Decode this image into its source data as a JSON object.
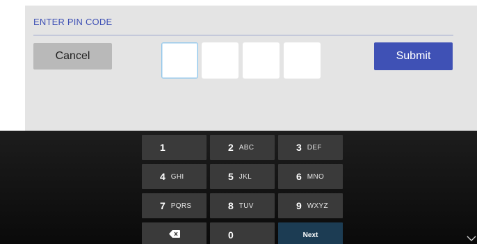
{
  "dialog": {
    "title": "ENTER PIN CODE",
    "cancel_label": "Cancel",
    "submit_label": "Submit",
    "pin_digits": [
      "",
      "",
      "",
      ""
    ]
  },
  "keypad": {
    "keys": [
      {
        "num": "1",
        "letters": ""
      },
      {
        "num": "2",
        "letters": "ABC"
      },
      {
        "num": "3",
        "letters": "DEF"
      },
      {
        "num": "4",
        "letters": "GHI"
      },
      {
        "num": "5",
        "letters": "JKL"
      },
      {
        "num": "6",
        "letters": "MNO"
      },
      {
        "num": "7",
        "letters": "PQRS"
      },
      {
        "num": "8",
        "letters": "TUV"
      },
      {
        "num": "9",
        "letters": "WXYZ"
      },
      {
        "num": "0",
        "letters": ""
      }
    ],
    "next_label": "Next",
    "backspace_icon": "backspace-icon"
  },
  "colors": {
    "accent": "#3f51b5",
    "next_key": "#1c3c53",
    "key": "#3a3a3a"
  }
}
